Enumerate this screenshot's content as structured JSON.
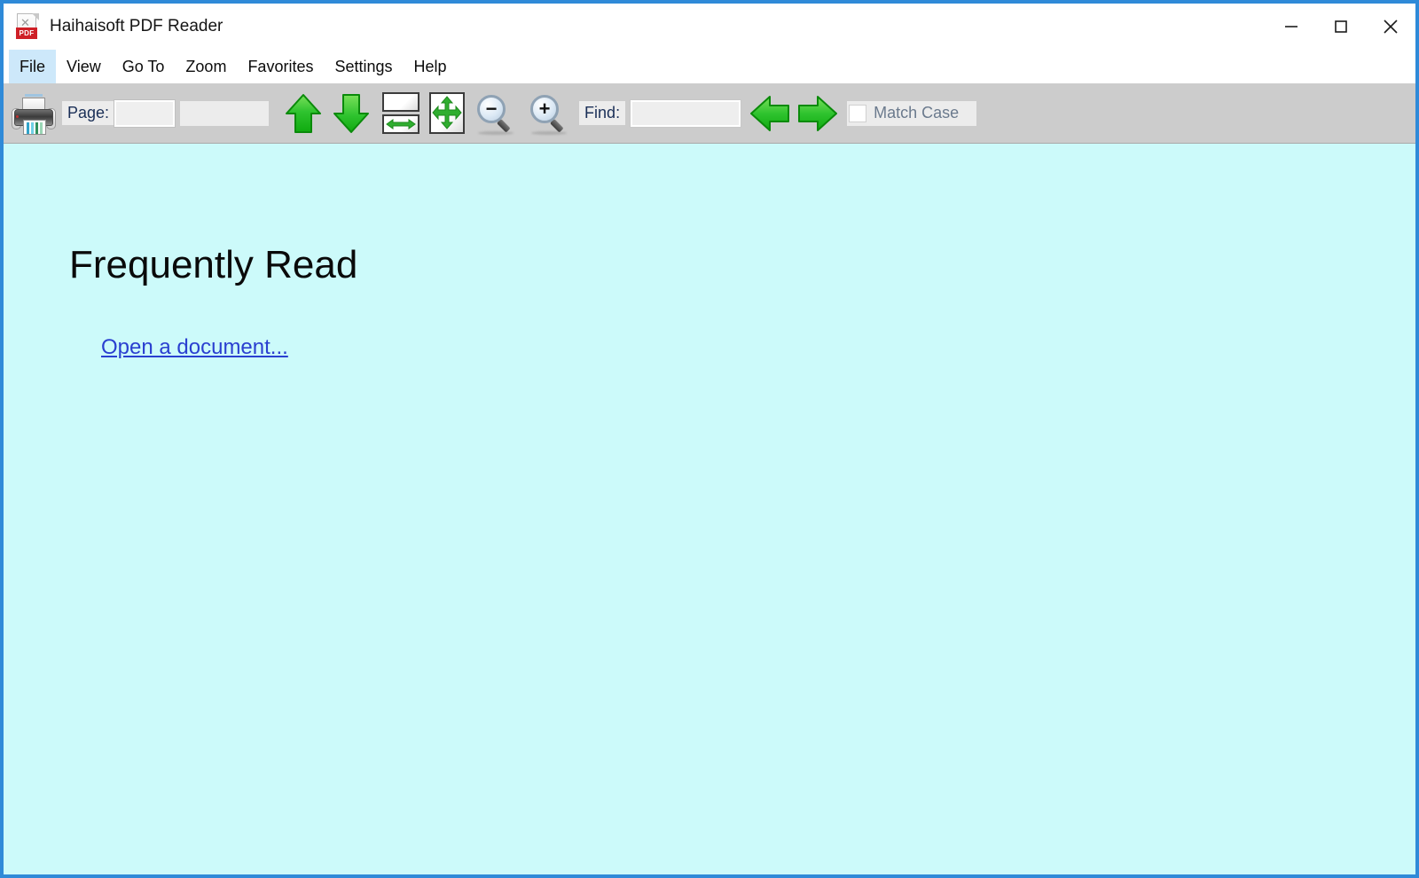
{
  "window": {
    "title": "Haihaisoft PDF Reader",
    "app_icon": "pdf-file-icon",
    "border_color": "#2f8ad8",
    "controls": {
      "minimize": "minimize-icon",
      "maximize": "maximize-icon",
      "close": "close-icon"
    }
  },
  "menubar": {
    "items": [
      {
        "label": "File",
        "active": true
      },
      {
        "label": "View",
        "active": false
      },
      {
        "label": "Go To",
        "active": false
      },
      {
        "label": "Zoom",
        "active": false
      },
      {
        "label": "Favorites",
        "active": false
      },
      {
        "label": "Settings",
        "active": false
      },
      {
        "label": "Help",
        "active": false
      }
    ],
    "highlight_color": "#cde8fa"
  },
  "toolbar": {
    "background_color": "#cccccc",
    "print_icon": "printer-icon",
    "page_label": "Page:",
    "page_value": "",
    "page_placeholder": "",
    "page_total": "",
    "prev_page_icon": "green-up-arrow-icon",
    "next_page_icon": "green-down-arrow-icon",
    "fit_width_icon": "fit-width-icon",
    "fit_page_icon": "fit-page-icon",
    "zoom_out_icon": "zoom-out-magnifier-icon",
    "zoom_out_sign": "−",
    "zoom_in_icon": "zoom-in-magnifier-icon",
    "zoom_in_sign": "+",
    "find_label": "Find:",
    "find_value": "",
    "find_placeholder": "",
    "find_prev_icon": "green-left-arrow-icon",
    "find_next_icon": "green-right-arrow-icon",
    "match_case_label": "Match Case",
    "match_case_checked": false
  },
  "content": {
    "background_color": "#ccfafa",
    "heading": "Frequently Read",
    "open_document_link": "Open a document...",
    "link_color": "#2a3fd0"
  }
}
